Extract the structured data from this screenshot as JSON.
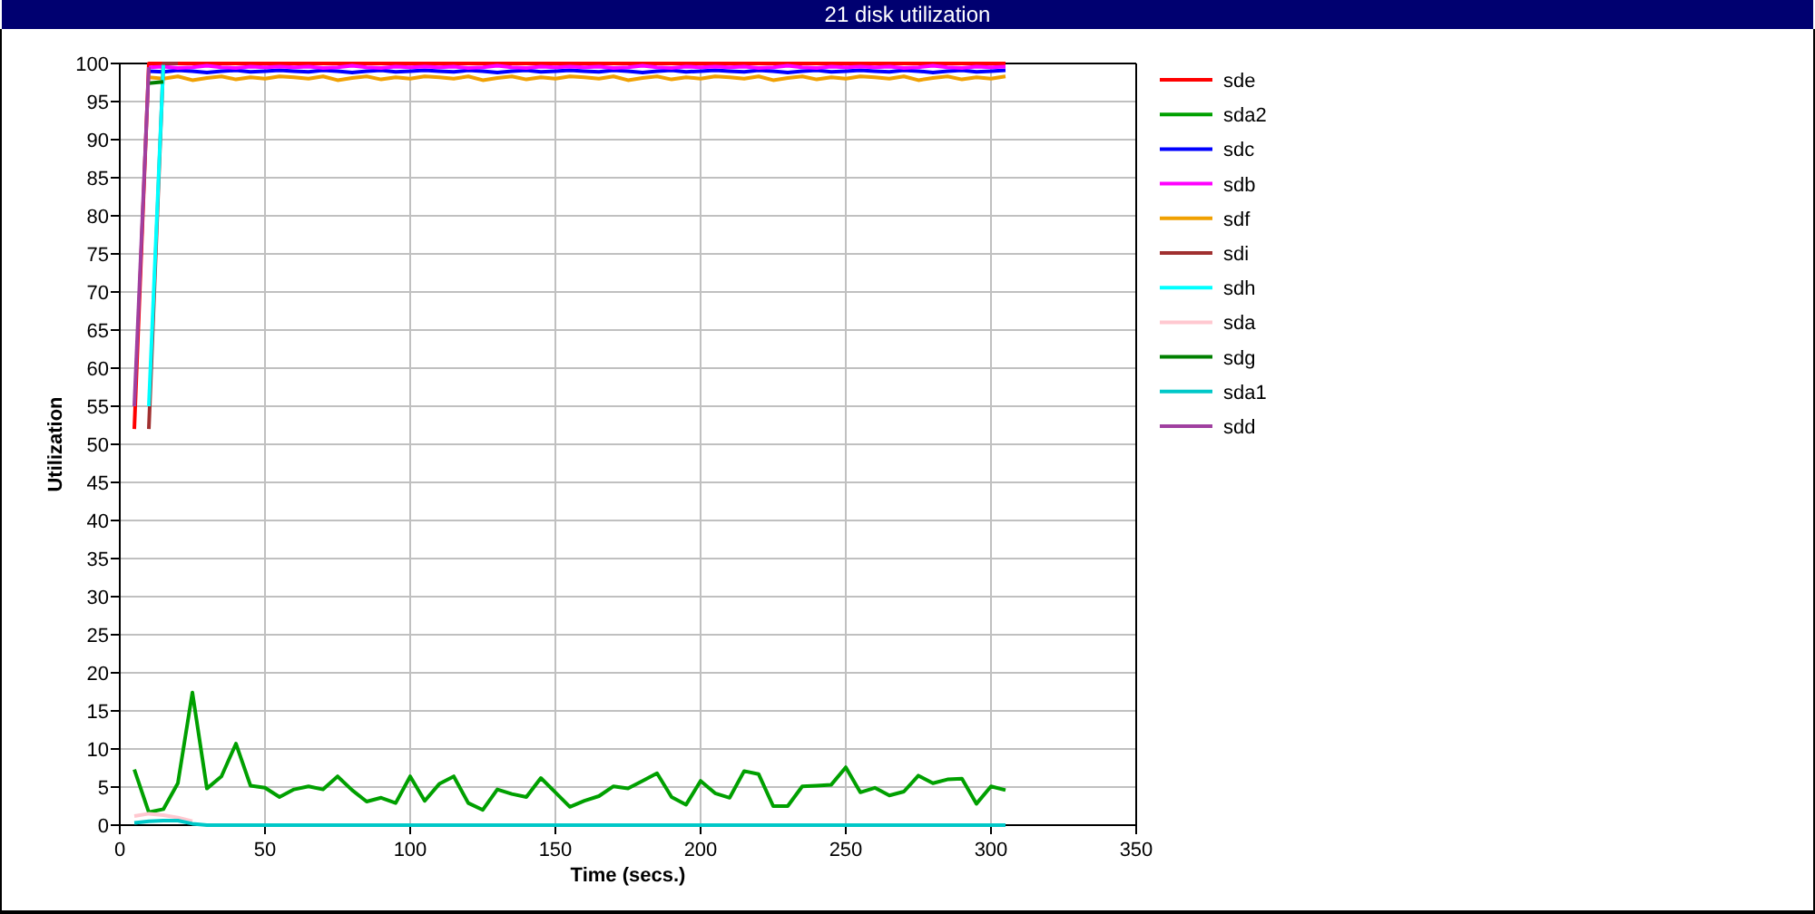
{
  "chart_data": {
    "type": "line",
    "title": "21 disk utilization",
    "xlabel": "Time (secs.)",
    "ylabel": "Utilization",
    "grid": true,
    "legend": true,
    "x": [
      5,
      10,
      15,
      20,
      25,
      30,
      35,
      40,
      45,
      50,
      55,
      60,
      65,
      70,
      75,
      80,
      85,
      90,
      95,
      100,
      105,
      110,
      115,
      120,
      125,
      130,
      135,
      140,
      145,
      150,
      155,
      160,
      165,
      170,
      175,
      180,
      185,
      190,
      195,
      200,
      205,
      210,
      215,
      220,
      225,
      230,
      235,
      240,
      245,
      250,
      255,
      260,
      265,
      270,
      275,
      280,
      285,
      290,
      295,
      300,
      305
    ],
    "xlim": [
      0,
      350
    ],
    "ylim": [
      0,
      100
    ],
    "xticks": [
      0,
      50,
      100,
      150,
      200,
      250,
      300,
      350
    ],
    "yticks": [
      0,
      5,
      10,
      15,
      20,
      25,
      30,
      35,
      40,
      45,
      50,
      55,
      60,
      65,
      70,
      75,
      80,
      85,
      90,
      95,
      100
    ],
    "series": [
      {
        "name": "sde",
        "color": "#ff0000",
        "values": [
          52,
          100,
          100,
          100,
          100,
          100,
          100,
          100,
          100,
          100,
          100,
          100,
          100,
          100,
          100,
          100,
          100,
          100,
          100,
          100,
          100,
          100,
          100,
          100,
          100,
          100,
          100,
          100,
          100,
          100,
          100,
          100,
          100,
          100,
          100,
          100,
          100,
          100,
          100,
          100,
          100,
          100,
          100,
          100,
          100,
          100,
          100,
          100,
          100,
          100,
          100,
          100,
          100,
          100,
          100,
          100,
          100,
          100,
          100,
          100,
          100
        ]
      },
      {
        "name": "sda2",
        "color": "#00a000",
        "values": [
          7.3,
          1.7,
          2.1,
          5.5,
          17.4,
          4.8,
          6.4,
          10.7,
          5.2,
          4.9,
          3.7,
          4.7,
          5.1,
          4.7,
          6.4,
          4.6,
          3.1,
          3.6,
          2.9,
          6.4,
          3.2,
          5.4,
          6.4,
          2.9,
          2.0,
          4.7,
          4.1,
          3.7,
          6.2,
          4.3,
          2.4,
          3.2,
          3.8,
          5.1,
          4.8,
          5.8,
          6.8,
          3.7,
          2.7,
          5.8,
          4.2,
          3.6,
          7.1,
          6.7,
          2.5,
          2.5,
          5.1,
          5.2,
          5.3,
          7.6,
          4.3,
          4.9,
          3.9,
          4.4,
          6.5,
          5.5,
          6.0,
          6.1,
          2.8,
          5.1,
          4.6
        ]
      },
      {
        "name": "sdc",
        "color": "#0000ff",
        "values": [
          null,
          99.0,
          98.9,
          99.1,
          99.0,
          98.8,
          99.0,
          99.1,
          98.9,
          99.0,
          99.1,
          99.0,
          98.9,
          99.1,
          99.0,
          98.8,
          99.0,
          99.1,
          98.9,
          99.0,
          99.1,
          99.0,
          98.9,
          99.1,
          99.0,
          98.8,
          99.0,
          99.1,
          98.9,
          99.0,
          99.1,
          99.0,
          98.9,
          99.1,
          99.0,
          98.8,
          99.0,
          99.1,
          98.9,
          99.0,
          99.1,
          99.0,
          98.9,
          99.1,
          99.0,
          98.8,
          99.0,
          99.1,
          98.9,
          99.0,
          99.1,
          99.0,
          98.9,
          99.1,
          99.0,
          98.8,
          99.0,
          99.1,
          98.9,
          99.0,
          99.1
        ]
      },
      {
        "name": "sdb",
        "color": "#ff00ff",
        "values": [
          null,
          99.5,
          99.6,
          99.4,
          99.5,
          99.7,
          99.5,
          99.4,
          99.6,
          99.5,
          99.6,
          99.5,
          99.6,
          99.4,
          99.5,
          99.7,
          99.5,
          99.4,
          99.6,
          99.5,
          99.6,
          99.5,
          99.6,
          99.4,
          99.5,
          99.7,
          99.5,
          99.4,
          99.6,
          99.5,
          99.6,
          99.5,
          99.6,
          99.4,
          99.5,
          99.7,
          99.5,
          99.4,
          99.6,
          99.5,
          99.6,
          99.5,
          99.6,
          99.4,
          99.5,
          99.7,
          99.5,
          99.4,
          99.6,
          99.5,
          99.6,
          99.5,
          99.6,
          99.4,
          99.5,
          99.7,
          99.5,
          99.4,
          99.6,
          99.5,
          99.6
        ]
      },
      {
        "name": "sdf",
        "color": "#f0a000",
        "values": [
          null,
          98.2,
          98.0,
          98.3,
          97.8,
          98.1,
          98.3,
          97.9,
          98.2,
          98.0,
          98.3,
          98.2,
          98.0,
          98.3,
          97.8,
          98.1,
          98.3,
          97.9,
          98.2,
          98.0,
          98.3,
          98.2,
          98.0,
          98.3,
          97.8,
          98.1,
          98.3,
          97.9,
          98.2,
          98.0,
          98.3,
          98.2,
          98.0,
          98.3,
          97.8,
          98.1,
          98.3,
          97.9,
          98.2,
          98.0,
          98.3,
          98.2,
          98.0,
          98.3,
          97.8,
          98.1,
          98.3,
          97.9,
          98.2,
          98.0,
          98.3,
          98.2,
          98.0,
          98.3,
          97.8,
          98.1,
          98.3,
          97.9,
          98.2,
          98.0,
          98.3
        ]
      },
      {
        "name": "sdi",
        "color": "#a03030",
        "values": [
          null,
          52,
          100,
          100,
          null,
          null,
          null,
          null,
          null,
          null,
          null,
          null,
          null,
          null,
          null,
          null,
          null,
          null,
          null,
          null,
          null,
          null,
          null,
          null,
          null,
          null,
          null,
          null,
          null,
          null,
          null,
          null,
          null,
          null,
          null,
          null,
          null,
          null,
          null,
          null,
          null,
          null,
          null,
          null,
          null,
          null,
          null,
          null,
          null,
          null,
          null,
          null,
          null,
          null,
          null,
          null,
          null,
          null,
          null,
          null,
          null
        ]
      },
      {
        "name": "sdh",
        "color": "#00ffff",
        "values": [
          null,
          55,
          99.8,
          null,
          null,
          null,
          null,
          null,
          null,
          null,
          null,
          null,
          null,
          null,
          null,
          null,
          null,
          null,
          null,
          null,
          null,
          null,
          null,
          null,
          null,
          null,
          null,
          null,
          null,
          null,
          null,
          null,
          null,
          null,
          null,
          null,
          null,
          null,
          null,
          null,
          null,
          null,
          null,
          null,
          null,
          null,
          null,
          null,
          null,
          null,
          null,
          null,
          null,
          null,
          null,
          null,
          null,
          null,
          null,
          null,
          null
        ]
      },
      {
        "name": "sda",
        "color": "#ffc8d0",
        "values": [
          1.2,
          1.5,
          1.3,
          1.0,
          0.5,
          null,
          null,
          null,
          null,
          null,
          null,
          null,
          null,
          null,
          null,
          null,
          null,
          null,
          null,
          null,
          null,
          null,
          null,
          null,
          null,
          null,
          null,
          null,
          null,
          null,
          null,
          null,
          null,
          null,
          null,
          null,
          null,
          null,
          null,
          null,
          null,
          null,
          null,
          null,
          null,
          null,
          null,
          null,
          null,
          null,
          null,
          null,
          null,
          null,
          null,
          null,
          null,
          null,
          null,
          null,
          null
        ]
      },
      {
        "name": "sdg",
        "color": "#008000",
        "values": [
          null,
          97.4,
          97.6,
          null,
          null,
          null,
          null,
          null,
          null,
          null,
          null,
          null,
          null,
          null,
          null,
          null,
          null,
          null,
          null,
          null,
          null,
          null,
          null,
          null,
          null,
          null,
          null,
          null,
          null,
          null,
          null,
          null,
          null,
          null,
          null,
          null,
          null,
          null,
          null,
          null,
          null,
          null,
          null,
          null,
          null,
          null,
          null,
          null,
          null,
          null,
          null,
          null,
          null,
          null,
          null,
          null,
          null,
          null,
          null,
          null,
          null
        ]
      },
      {
        "name": "sda1",
        "color": "#00c8c8",
        "values": [
          0.3,
          0.5,
          0.6,
          0.6,
          0.2,
          0,
          0,
          0,
          0,
          0,
          0,
          0,
          0,
          0,
          0,
          0,
          0,
          0,
          0,
          0,
          0,
          0,
          0,
          0,
          0,
          0,
          0,
          0,
          0,
          0,
          0,
          0,
          0,
          0,
          0,
          0,
          0,
          0,
          0,
          0,
          0,
          0,
          0,
          0,
          0,
          0,
          0,
          0,
          0,
          0,
          0,
          0,
          0,
          0,
          0,
          0,
          0,
          0,
          0,
          0,
          0
        ]
      },
      {
        "name": "sdd",
        "color": "#a040a0",
        "values": [
          55,
          99.5,
          null,
          null,
          null,
          null,
          null,
          null,
          null,
          null,
          null,
          null,
          null,
          null,
          null,
          null,
          null,
          null,
          null,
          null,
          null,
          null,
          null,
          null,
          null,
          null,
          null,
          null,
          null,
          null,
          null,
          null,
          null,
          null,
          null,
          null,
          null,
          null,
          null,
          null,
          null,
          null,
          null,
          null,
          null,
          null,
          null,
          null,
          null,
          null,
          null,
          null,
          null,
          null,
          null,
          null,
          null,
          null,
          null,
          null,
          null
        ]
      }
    ]
  }
}
